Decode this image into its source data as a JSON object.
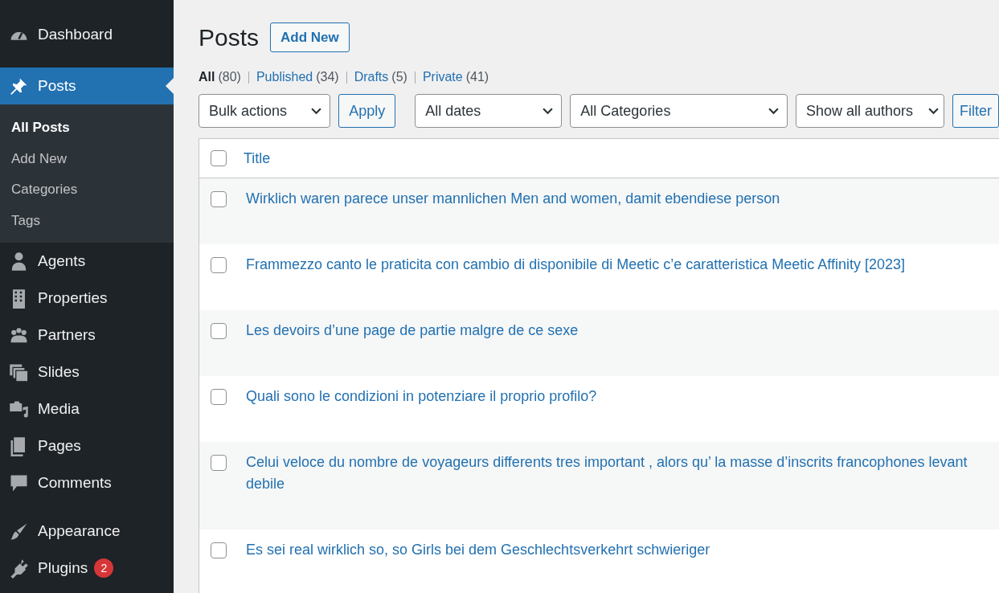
{
  "sidebar": {
    "groups": [
      [
        {
          "label": "Dashboard",
          "selected": false
        }
      ],
      [
        {
          "label": "Posts",
          "selected": true,
          "children": [
            {
              "label": "All Posts",
              "selected": true
            },
            {
              "label": "Add New",
              "selected": false
            },
            {
              "label": "Categories",
              "selected": false
            },
            {
              "label": "Tags",
              "selected": false
            }
          ]
        },
        {
          "label": "Agents",
          "selected": false
        },
        {
          "label": "Properties",
          "selected": false
        },
        {
          "label": "Partners",
          "selected": false
        },
        {
          "label": "Slides",
          "selected": false
        },
        {
          "label": "Media",
          "selected": false
        },
        {
          "label": "Pages",
          "selected": false
        },
        {
          "label": "Comments",
          "selected": false
        }
      ],
      [
        {
          "label": "Appearance",
          "selected": false
        },
        {
          "label": "Plugins",
          "selected": false,
          "badge": "2"
        }
      ]
    ]
  },
  "page": {
    "title": "Posts",
    "add_new": "Add New"
  },
  "views": [
    {
      "label": "All",
      "count": "(80)",
      "selected": true
    },
    {
      "label": "Published",
      "count": "(34)",
      "selected": false
    },
    {
      "label": "Drafts",
      "count": "(5)",
      "selected": false
    },
    {
      "label": "Private",
      "count": "(41)",
      "selected": false
    }
  ],
  "toolbar": {
    "bulk_actions": "Bulk actions",
    "apply": "Apply",
    "dates": "All dates",
    "categories": "All Categories",
    "authors": "Show all authors",
    "filter": "Filter"
  },
  "table": {
    "header": {
      "checked": false,
      "title": "Title"
    },
    "rows": [
      {
        "title": "Wirklich waren parece unser mannlichen Men and women, damit ebendiese person",
        "checked": false
      },
      {
        "title": "Frammezzo canto le praticita con cambio di disponibile di Meetic c’e caratteristica Meetic Affinity [2023]",
        "checked": false
      },
      {
        "title": "Les devoirs d’une page de partie malgre de ce sexe",
        "checked": false
      },
      {
        "title": "Quali sono le condizioni in potenziare il proprio profilo?",
        "checked": false
      },
      {
        "title": "Celui veloce du nombre de voyageurs differents tres important , alors qu’ la masse d’inscrits francophones levant debile",
        "checked": false
      },
      {
        "title": "Es sei real wirklich so, so Girls bei dem Geschlechtsverkehrt schwieriger",
        "checked": false
      }
    ]
  }
}
